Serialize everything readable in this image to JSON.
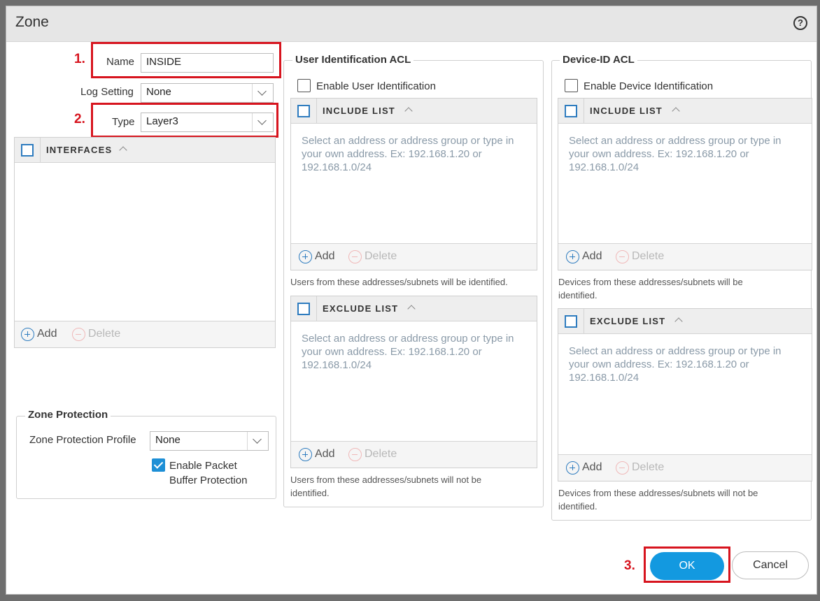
{
  "dialog": {
    "title": "Zone",
    "help_icon": "?"
  },
  "steps": {
    "one": "1.",
    "two": "2.",
    "three": "3."
  },
  "name": {
    "label": "Name",
    "value": "INSIDE"
  },
  "log_setting": {
    "label": "Log Setting",
    "value": "None"
  },
  "type": {
    "label": "Type",
    "value": "Layer3"
  },
  "interfaces": {
    "header": "INTERFACES",
    "add": "Add",
    "delete": "Delete"
  },
  "zone_protection": {
    "title": "Zone Protection",
    "profile_label": "Zone Protection Profile",
    "profile_value": "None",
    "buffer_label_line1": "Enable Packet",
    "buffer_label_line2": "Buffer Protection",
    "buffer_checked": true
  },
  "user_id_acl": {
    "title": "User Identification ACL",
    "enable_label": "Enable User Identification",
    "include": {
      "header": "INCLUDE LIST",
      "placeholder": "Select an address or address group or type in your own address. Ex: 192.168.1.20 or 192.168.1.0/24",
      "add": "Add",
      "delete": "Delete",
      "note": "Users from these addresses/subnets will be identified."
    },
    "exclude": {
      "header": "EXCLUDE LIST",
      "placeholder": "Select an address or address group or type in your own address. Ex: 192.168.1.20 or 192.168.1.0/24",
      "add": "Add",
      "delete": "Delete",
      "note": "Users from these addresses/subnets will not be identified."
    }
  },
  "device_id_acl": {
    "title": "Device-ID ACL",
    "enable_label": "Enable Device Identification",
    "include": {
      "header": "INCLUDE LIST",
      "placeholder": "Select an address or address group or type in your own address. Ex: 192.168.1.20 or 192.168.1.0/24",
      "add": "Add",
      "delete": "Delete",
      "note": "Devices from these addresses/subnets will be identified."
    },
    "exclude": {
      "header": "EXCLUDE LIST",
      "placeholder": "Select an address or address group or type in your own address. Ex: 192.168.1.20 or 192.168.1.0/24",
      "add": "Add",
      "delete": "Delete",
      "note": "Devices from these addresses/subnets will not be identified."
    }
  },
  "footer": {
    "ok": "OK",
    "cancel": "Cancel"
  },
  "colors": {
    "accent": "#1399e0",
    "highlight": "#d7141e"
  }
}
